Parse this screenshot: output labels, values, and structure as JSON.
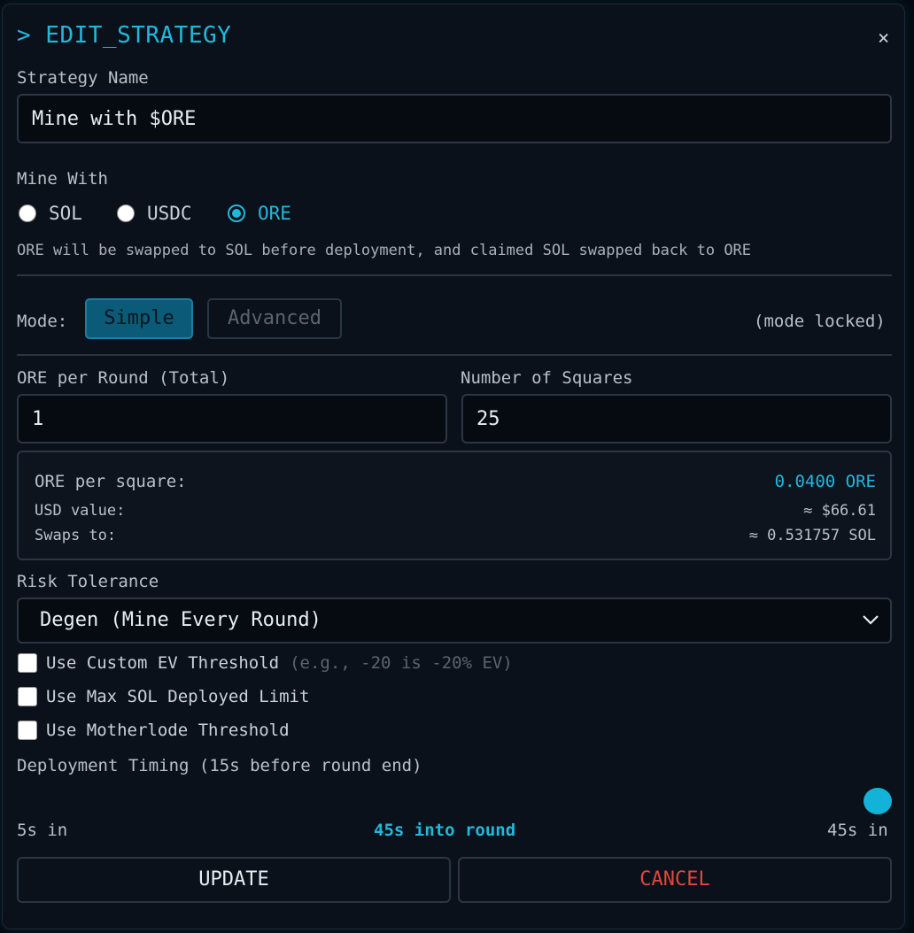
{
  "modal": {
    "title": "> EDIT_STRATEGY",
    "close_icon": "×"
  },
  "strategy_name": {
    "label": "Strategy Name",
    "value": "Mine with $ORE"
  },
  "mine_with": {
    "label": "Mine With",
    "options": [
      "SOL",
      "USDC",
      "ORE"
    ],
    "selected": "ORE",
    "note": "ORE will be swapped to SOL before deployment, and claimed SOL swapped back to ORE"
  },
  "mode": {
    "label": "Mode:",
    "simple": "Simple",
    "advanced": "Advanced",
    "locked_note": "(mode locked)"
  },
  "ore_per_round": {
    "label": "ORE per Round (Total)",
    "value": "1"
  },
  "num_squares": {
    "label": "Number of Squares",
    "value": "25"
  },
  "summary": {
    "per_square_label": "ORE per square:",
    "per_square_value": "0.0400 ORE",
    "usd_label": "USD value:",
    "usd_value": "≈ $66.61",
    "swaps_label": "Swaps to:",
    "swaps_value": "≈ 0.531757 SOL"
  },
  "risk": {
    "label": "Risk Tolerance",
    "selected": "Degen (Mine Every Round)"
  },
  "options": {
    "custom_ev_label": "Use Custom EV Threshold",
    "custom_ev_hint": "(e.g., -20 is -20% EV)",
    "max_sol_label": "Use Max SOL Deployed Limit",
    "motherlode_label": "Use Motherlode Threshold"
  },
  "timing": {
    "label": "Deployment Timing (15s before round end)",
    "min_label": "5s in",
    "current_label": "45s into round",
    "max_label": "45s in",
    "slider_fraction": 1.0
  },
  "actions": {
    "update": "UPDATE",
    "cancel": "CANCEL"
  },
  "colors": {
    "accent": "#22b8dc",
    "danger": "#e0473f"
  }
}
